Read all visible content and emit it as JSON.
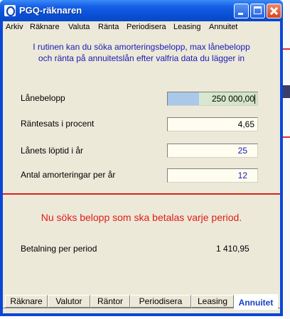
{
  "window": {
    "title": "PGQ-räknaren"
  },
  "menu": [
    "Arkiv",
    "Räknare",
    "Valuta",
    "Ränta",
    "Periodisera",
    "Leasing",
    "Annuitet"
  ],
  "intro": {
    "line1": "I rutinen kan du söka amorteringsbelopp, max lånebelopp",
    "line2": "och ränta på annuitetslån efter valfria data du lägger in"
  },
  "fields": [
    {
      "label": "Lånebelopp",
      "value": "250 000,00"
    },
    {
      "label": "Räntesats i procent",
      "value": "4,65"
    },
    {
      "label": "Lånets löptid i år",
      "value": "25"
    },
    {
      "label": "Antal amorteringar per år",
      "value": "12"
    }
  ],
  "message": "Nu söks belopp som ska betalas varje period.",
  "result": {
    "label": "Betalning per period",
    "value": "1 410,95"
  },
  "tabs": [
    "Räknare",
    "Valutor",
    "Räntor",
    "Periodisera",
    "Leasing",
    "Annuitet"
  ],
  "active_tab": "Annuitet",
  "colors": {
    "accent_blue": "#1a1ab8",
    "alert_red": "#dd1f1f",
    "title_blue": "#0a46d8"
  }
}
